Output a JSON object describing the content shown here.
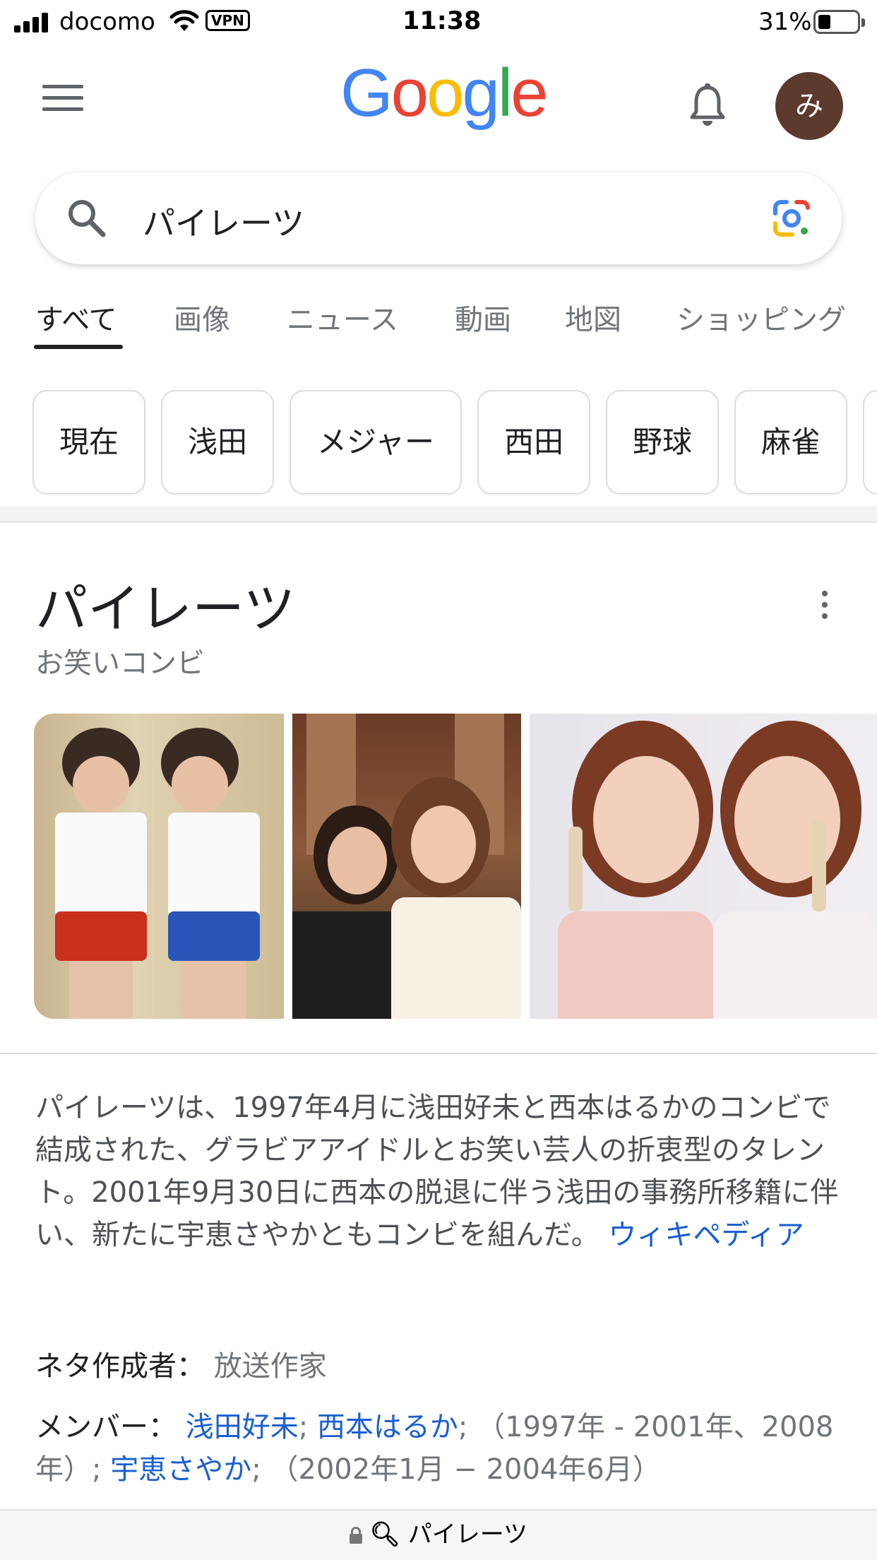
{
  "status_bar": {
    "carrier": "docomo",
    "vpn": "VPN",
    "time": "11:38",
    "battery": "31%",
    "battery_level": 0.31
  },
  "header": {
    "logo_letters": [
      "G",
      "o",
      "o",
      "g",
      "l",
      "e"
    ],
    "logo_colors": [
      "#4285F4",
      "#EA4335",
      "#FBBC05",
      "#4285F4",
      "#34A853",
      "#EA4335"
    ],
    "avatar_initial": "み",
    "avatar_color": "#5d3a2e"
  },
  "search": {
    "query": "パイレーツ"
  },
  "tabs": [
    {
      "label": "すべて",
      "active": true
    },
    {
      "label": "画像"
    },
    {
      "label": "ニュース"
    },
    {
      "label": "動画"
    },
    {
      "label": "地図"
    },
    {
      "label": "ショッピング"
    }
  ],
  "chips": [
    "現在",
    "浅田",
    "メジャー",
    "西田",
    "野球",
    "麻雀"
  ],
  "knowledge_panel": {
    "title": "パイレーツ",
    "subtitle": "お笑いコンビ",
    "description": "パイレーツは、1997年4月に浅田好未と西本はるかのコンビで結成された、グラビアアイドルとお笑い芸人の折衷型のタレント。2001年9月30日に西本の脱退に伴う浅田の事務所移籍に伴い、新たに宇恵さやかともコンビを組んだ。",
    "source_link": "ウィキペディア",
    "facts": {
      "writer_label": "ネタ作成者：",
      "writer_value": "放送作家",
      "members_label": "メンバー：",
      "member1": "浅田好未",
      "sep1": "; ",
      "member2": "西本はるか",
      "period1": "; （1997年 - 2001年、2008年）; ",
      "member3": "宇恵さやか",
      "period2": "; （2002年1月 − 2004年6月）"
    }
  },
  "url_bar": {
    "text": "パイレーツ"
  },
  "colors": {
    "link": "#1a5fd0",
    "accent": "#4285F4"
  }
}
